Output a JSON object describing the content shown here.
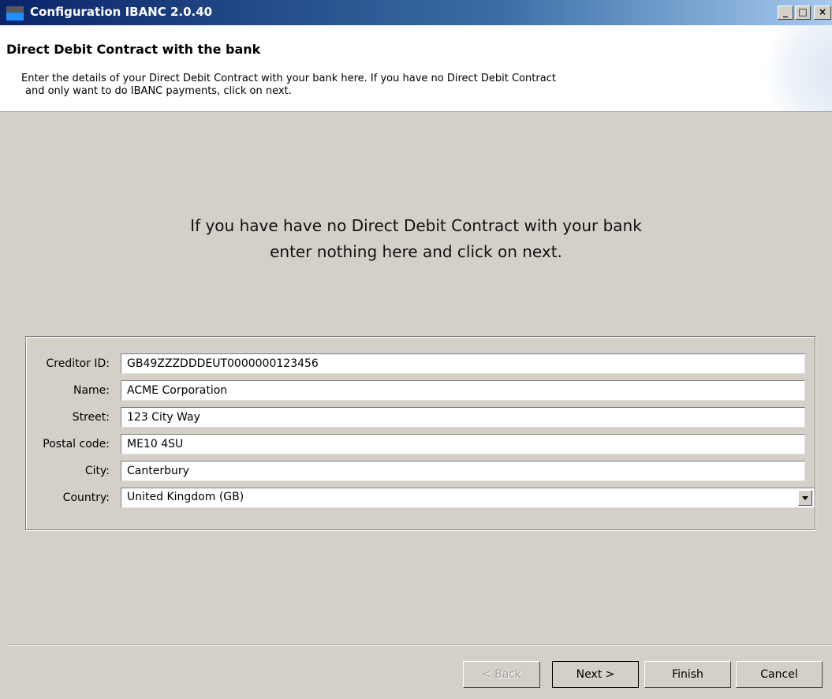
{
  "window": {
    "title": "Configuration IBANC 2.0.40",
    "controls": {
      "minimize": "_",
      "maximize": "□",
      "close": "×"
    }
  },
  "header": {
    "title": "Direct Debit Contract with the bank",
    "description_line1": "Enter the details of your Direct Debit Contract with your bank here. If you have no Direct Debit Contract",
    "description_line2": "and only want to do IBANC payments, click on next."
  },
  "hint": {
    "line1": "If you have have no Direct Debit Contract with your bank",
    "line2": "enter nothing here and click on next."
  },
  "form": {
    "creditor_id": {
      "label": "Creditor ID:",
      "value": "GB49ZZZDDDEUT0000000123456"
    },
    "name": {
      "label": "Name:",
      "value": "ACME Corporation"
    },
    "street": {
      "label": "Street:",
      "value": "123 City Way"
    },
    "postal_code": {
      "label": "Postal code:",
      "value": "ME10 4SU"
    },
    "city": {
      "label": "City:",
      "value": "Canterbury"
    },
    "country": {
      "label": "Country:",
      "value": "United Kingdom (GB)"
    }
  },
  "buttons": {
    "back": "< Back",
    "next": "Next >",
    "finish": "Finish",
    "cancel": "Cancel"
  },
  "icons": {
    "app": "app-icon",
    "dropdown": "chevron-down-icon"
  }
}
